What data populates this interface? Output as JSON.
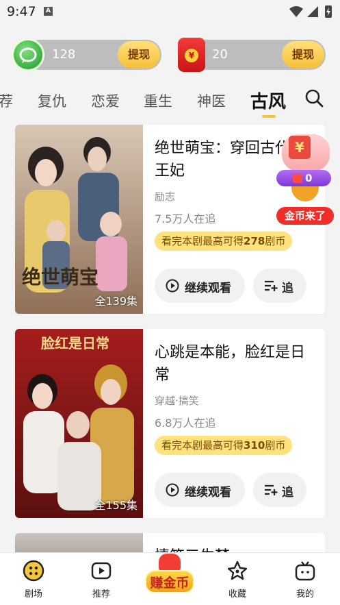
{
  "status_bar": {
    "time": "9:47",
    "notif_icon": "A"
  },
  "coins": {
    "left": {
      "count": "128",
      "withdraw_label": "提现"
    },
    "right": {
      "count": "20",
      "withdraw_label": "提现"
    }
  },
  "tabs": [
    "荐",
    "复仇",
    "恋爱",
    "重生",
    "神医",
    "古风"
  ],
  "active_tab": "古风",
  "floating_widget": {
    "value": "0",
    "label": "金币来了",
    "box_glyph": "¥"
  },
  "cards": [
    {
      "title": "绝世萌宝：穿回古代当王妃",
      "genre": "励志",
      "followers": "7.5万人在追",
      "reward_prefix": "看完本剧最高可得",
      "reward_amount": "278",
      "reward_suffix": "剧币",
      "episodes": "全139集",
      "watch_label": "继续观看",
      "follow_label": "追"
    },
    {
      "title": "心跳是本能，脸红是日常",
      "genre": "穿越·搞笑",
      "followers": "6.8万人在追",
      "reward_prefix": "看完本剧最高可得",
      "reward_amount": "310",
      "reward_suffix": "剧币",
      "episodes": "全155集",
      "watch_label": "继续观看",
      "follow_label": "追"
    }
  ],
  "card3": {
    "title": "情笙三生梦"
  },
  "bottom_nav": {
    "theater": "剧场",
    "recommend": "推荐",
    "earn": "赚金币",
    "favorites": "收藏",
    "mine": "我的"
  },
  "colors": {
    "accent_yellow": "#f5c63a",
    "reward_bg": "#ffe27e",
    "red_label": "#f02d28"
  }
}
